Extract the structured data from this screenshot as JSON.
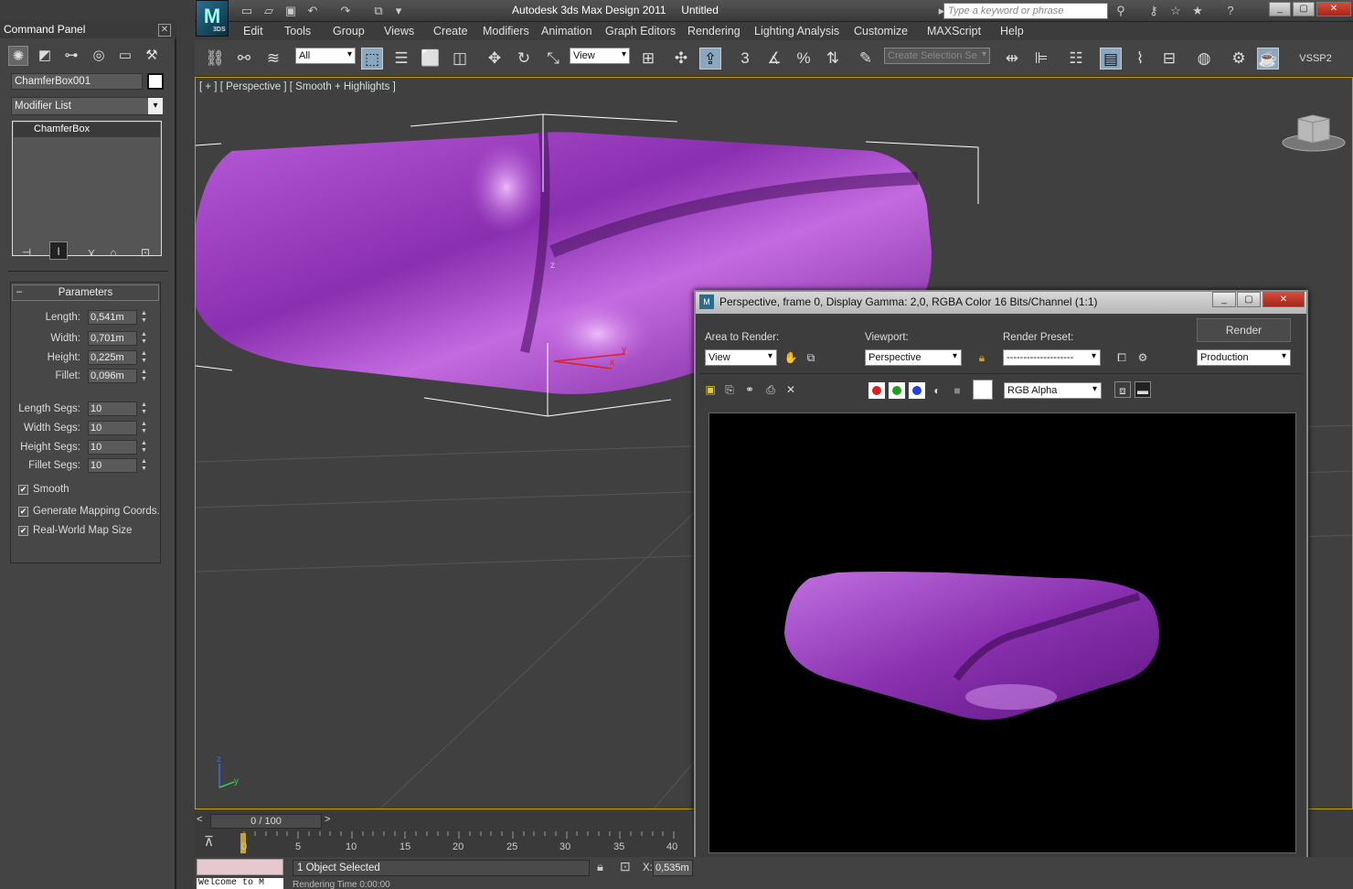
{
  "app": {
    "title": "Autodesk 3ds Max Design 2011",
    "document": "Untitled",
    "logo_text": "3DS",
    "search_placeholder": "Type a keyword or phrase"
  },
  "menu": [
    "Edit",
    "Tools",
    "Group",
    "Views",
    "Create",
    "Modifiers",
    "Animation",
    "Graph Editors",
    "Rendering",
    "Lighting Analysis",
    "Customize",
    "MAXScript",
    "Help"
  ],
  "toolbar": {
    "selection_filter": "All",
    "ref_coord": "View",
    "named_selection_placeholder": "Create Selection Se",
    "vssp_label": "VSSP2"
  },
  "command_panel": {
    "title": "Command Panel",
    "object_name": "ChamferBox001",
    "object_color": "#ffffff",
    "modifier_list": "Modifier List",
    "stack": [
      "ChamferBox"
    ],
    "rollout_title": "Parameters",
    "params": [
      {
        "label": "Length:",
        "value": "0,541m"
      },
      {
        "label": "Width:",
        "value": "0,701m"
      },
      {
        "label": "Height:",
        "value": "0,225m"
      },
      {
        "label": "Fillet:",
        "value": "0,096m"
      },
      {
        "label": "Length Segs:",
        "value": "10"
      },
      {
        "label": "Width Segs:",
        "value": "10"
      },
      {
        "label": "Height Segs:",
        "value": "10"
      },
      {
        "label": "Fillet Segs:",
        "value": "10"
      }
    ],
    "checks": [
      {
        "label": "Smooth",
        "checked": true
      },
      {
        "label": "Generate Mapping Coords.",
        "checked": true
      },
      {
        "label": "Real-World Map Size",
        "checked": true
      }
    ]
  },
  "viewport": {
    "label": "[ + ] [ Perspective ] [ Smooth + Highlights ]",
    "axis_x": "x",
    "axis_y": "y",
    "axis_z": "z",
    "object_color": "#b04ed0"
  },
  "render_frame": {
    "title": "Perspective, frame 0, Display Gamma: 2,0, RGBA Color 16 Bits/Channel (1:1)",
    "area_label": "Area to Render:",
    "area_value": "View",
    "viewport_label": "Viewport:",
    "viewport_value": "Perspective",
    "preset_label": "Render Preset:",
    "preset_value": "--------------------",
    "render_button": "Render",
    "render_mode": "Production",
    "channel_value": "RGB Alpha",
    "channel_colors": [
      "#e02020",
      "#20a020",
      "#2040e0"
    ]
  },
  "timeline": {
    "frame_counter": "0 / 100",
    "ticks": [
      "0",
      "5",
      "10",
      "15",
      "20",
      "25",
      "30",
      "35",
      "40"
    ]
  },
  "status": {
    "listener_text": "Welcome to M",
    "selection": "1 Object Selected",
    "x_label": "X:",
    "x_value": "0,535m",
    "render_time": "Rendering Time 0:00:00"
  }
}
